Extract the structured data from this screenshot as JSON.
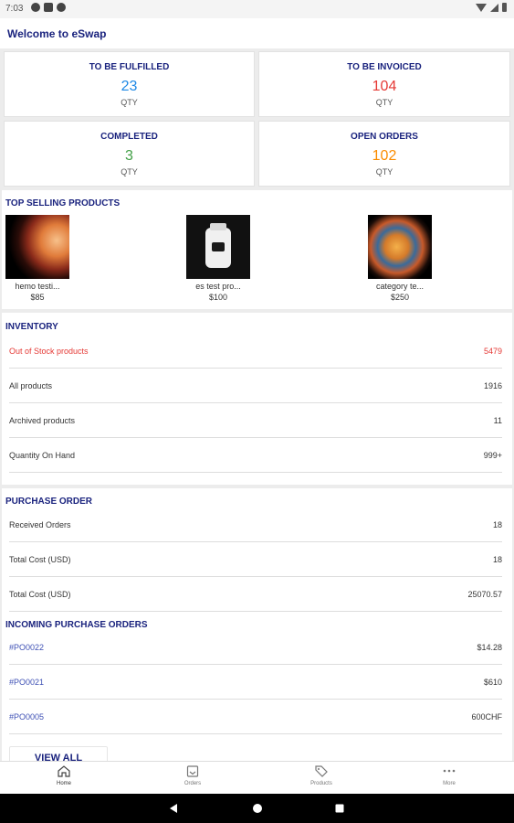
{
  "status": {
    "time": "7:03"
  },
  "welcome": "Welcome to eSwap",
  "stats": [
    {
      "title": "TO BE FULFILLED",
      "value": "23",
      "unit": "QTY",
      "color": "#1e88e5"
    },
    {
      "title": "TO BE INVOICED",
      "value": "104",
      "unit": "QTY",
      "color": "#e53935"
    },
    {
      "title": "COMPLETED",
      "value": "3",
      "unit": "QTY",
      "color": "#43a047"
    },
    {
      "title": "OPEN ORDERS",
      "value": "102",
      "unit": "QTY",
      "color": "#fb8c00"
    }
  ],
  "top_selling": {
    "title": "TOP SELLING PRODUCTS",
    "products": [
      {
        "name": "hemo testi...",
        "price": "$85"
      },
      {
        "name": "es test pro...",
        "price": "$100"
      },
      {
        "name": "category te...",
        "price": "$250"
      }
    ]
  },
  "inventory": {
    "title": "INVENTORY",
    "rows": [
      {
        "label": "Out of Stock products",
        "value": "5479"
      },
      {
        "label": "All products",
        "value": "1916"
      },
      {
        "label": "Archived products",
        "value": "11"
      },
      {
        "label": "Quantity On Hand",
        "value": "999+"
      }
    ]
  },
  "purchase_order": {
    "title": "PURCHASE ORDER",
    "rows": [
      {
        "label": "Received Orders",
        "value": "18"
      },
      {
        "label": "Total Cost (USD)",
        "value": "18"
      },
      {
        "label": "Total Cost (USD)",
        "value": "25070.57"
      }
    ]
  },
  "incoming": {
    "title": "INCOMING PURCHASE ORDERS",
    "rows": [
      {
        "label": "#PO0022",
        "value": "$14.28"
      },
      {
        "label": "#PO0021",
        "value": "$610"
      },
      {
        "label": "#PO0005",
        "value": "600CHF"
      }
    ],
    "view_all": "VIEW ALL"
  },
  "bottom_nav": [
    {
      "label": "Home",
      "icon": "home-icon"
    },
    {
      "label": "Orders",
      "icon": "orders-icon"
    },
    {
      "label": "Products",
      "icon": "tag-icon"
    },
    {
      "label": "More",
      "icon": "more-icon"
    }
  ],
  "colors": {
    "accent": "#1a237e",
    "alert": "#e53935",
    "link": "#3f51b5"
  }
}
